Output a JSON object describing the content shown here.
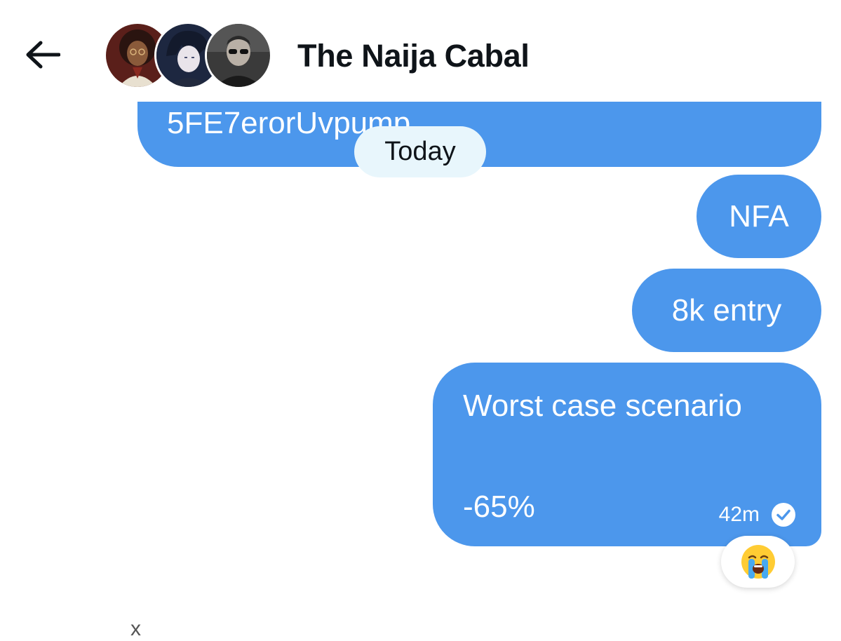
{
  "header": {
    "title": "The Naija Cabal",
    "back_icon": "arrow-left-icon",
    "avatars": [
      "avatar-1",
      "avatar-2",
      "avatar-3"
    ]
  },
  "messages": {
    "previous_text": "5FE7erorUvpump",
    "date_divider": "Today",
    "msg1": "NFA",
    "msg2": "8k entry",
    "msg3_line1": "Worst case scenario",
    "msg3_line2": "-65%",
    "msg3_time": "42m",
    "msg3_status_icon": "check-circle-icon",
    "reaction_icon": "crying-face-emoji"
  },
  "footer": {
    "text": "x"
  },
  "colors": {
    "bubble": "#4c97ec",
    "date_pill": "#e8f6fc",
    "text": "#0f1419"
  }
}
